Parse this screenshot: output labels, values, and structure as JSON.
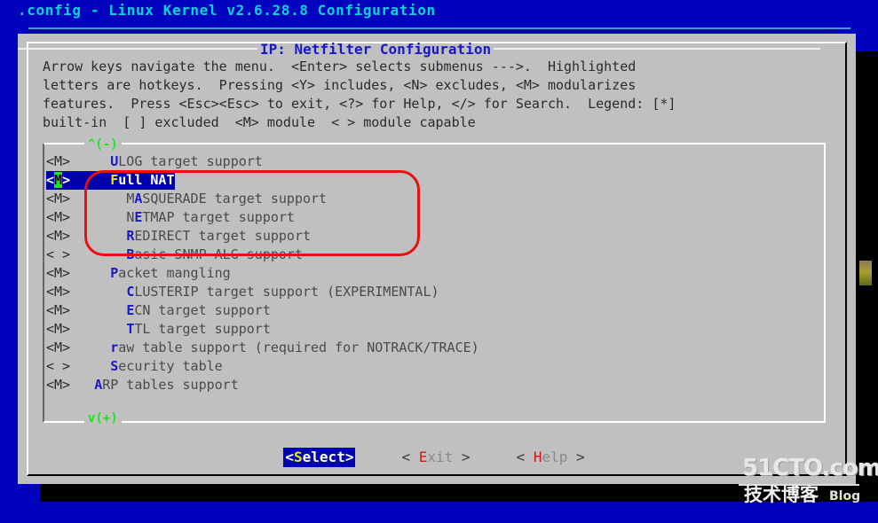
{
  "window": {
    "title": ".config - Linux Kernel v2.6.28.8 Configuration",
    "background_color": "#0000bf",
    "title_color": "#00d8d8"
  },
  "dialog": {
    "title": "IP: Netfilter Configuration",
    "title_color": "#1818c8",
    "background_color": "#c0c0c0",
    "help_text": "Arrow keys navigate the menu.  <Enter> selects submenus --->.  Highlighted\nletters are hotkeys.  Pressing <Y> includes, <N> excludes, <M> modularizes\nfeatures.  Press <Esc><Esc> to exit, <?> for Help, </> for Search.  Legend: [*]\nbuilt-in  [ ] excluded  <M> module  < > module capable"
  },
  "menu": {
    "scroll_up_indicator": "^(-)",
    "scroll_down_indicator": "v(+)",
    "selected_index": 1,
    "items": [
      {
        "tag": "<M>",
        "indent": 3,
        "hotkey": "U",
        "label": "LOG target support",
        "selected": false
      },
      {
        "tag": "<M>",
        "indent": 3,
        "hotkey": "F",
        "label": "ull NAT",
        "selected": true
      },
      {
        "tag": "<M>",
        "indent": 5,
        "prefix": "M",
        "hotkey": "A",
        "label": "SQUERADE target support",
        "selected": false
      },
      {
        "tag": "<M>",
        "indent": 5,
        "prefix": "N",
        "hotkey": "E",
        "label": "TMAP target support",
        "selected": false
      },
      {
        "tag": "<M>",
        "indent": 5,
        "hotkey": "R",
        "label": "EDIRECT target support",
        "selected": false
      },
      {
        "tag": "< >",
        "indent": 5,
        "hotkey": "B",
        "label": "asic SNMP-ALG support",
        "selected": false
      },
      {
        "tag": "<M>",
        "indent": 3,
        "hotkey": "P",
        "label": "acket mangling",
        "selected": false
      },
      {
        "tag": "<M>",
        "indent": 5,
        "hotkey": "C",
        "label": "LUSTERIP target support (EXPERIMENTAL)",
        "selected": false
      },
      {
        "tag": "<M>",
        "indent": 5,
        "hotkey": "E",
        "label": "CN target support",
        "selected": false
      },
      {
        "tag": "<M>",
        "indent": 5,
        "hotkey": "T",
        "label": "TL target support",
        "selected": false
      },
      {
        "tag": "<M>",
        "indent": 3,
        "hotkey": "r",
        "label": "aw table support (required for NOTRACK/TRACE)",
        "selected": false
      },
      {
        "tag": "< >",
        "indent": 3,
        "hotkey": "S",
        "label": "ecurity table",
        "selected": false
      },
      {
        "tag": "<M>",
        "indent": 1,
        "hotkey": "A",
        "label": "RP tables support",
        "selected": false
      }
    ]
  },
  "buttons": [
    {
      "name": "select",
      "open": "<",
      "hotkey": "S",
      "text": "elect",
      "close": ">",
      "active": true
    },
    {
      "name": "exit",
      "open": "<",
      "hotkey": "E",
      "text": "xit",
      "close": ">",
      "active": false
    },
    {
      "name": "help",
      "open": "<",
      "hotkey": "H",
      "text": "elp",
      "close": ">",
      "active": false
    }
  ],
  "annotation": {
    "type": "red-oval-highlight",
    "color": "#e81010",
    "encircles": [
      "Full NAT",
      "MASQUERADE target support",
      "NETMAP target support",
      "REDIRECT target support"
    ]
  },
  "watermark": {
    "line1": "51CTO.com",
    "line2": "技术博客",
    "line3": "Blog"
  }
}
